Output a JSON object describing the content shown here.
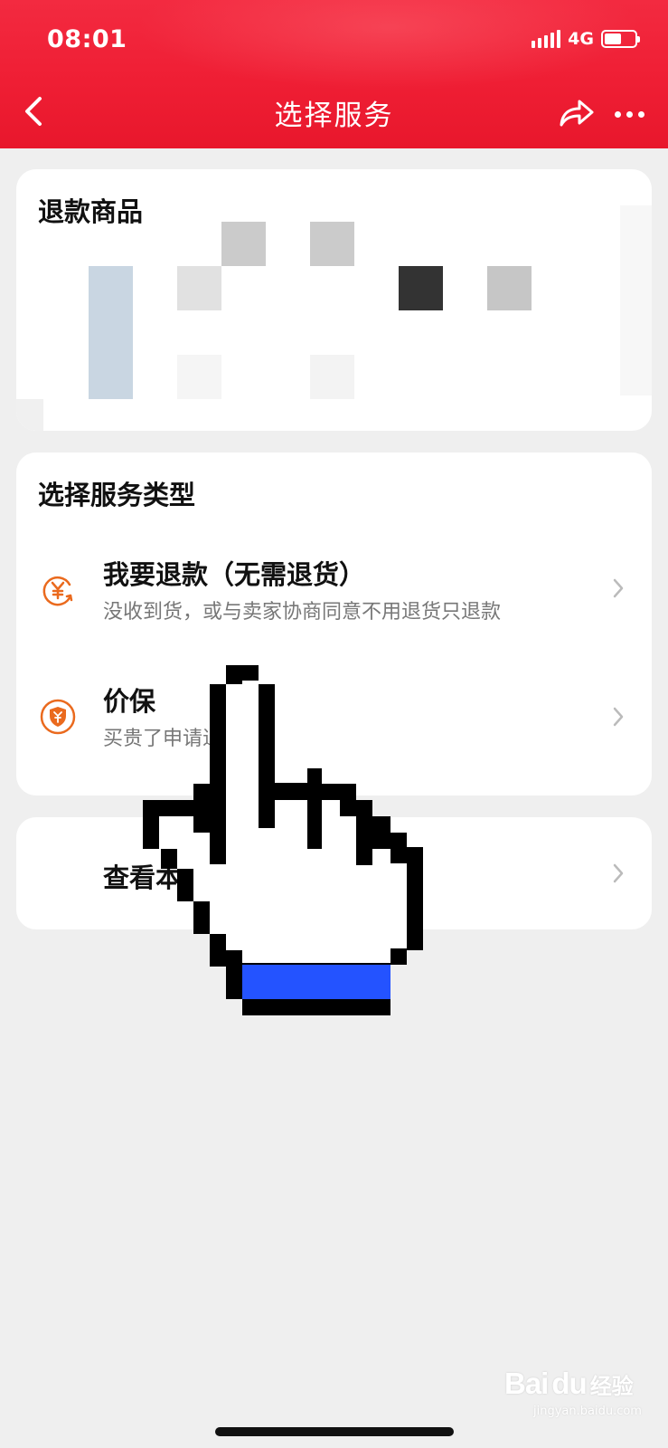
{
  "status_bar": {
    "time": "08:01",
    "network": "4G",
    "icons": [
      "signal-icon",
      "battery-icon"
    ]
  },
  "nav": {
    "title": "选择服务",
    "back_icon": "chevron-left-icon",
    "share_icon": "share-icon",
    "more_icon": "more-icon"
  },
  "refund_goods": {
    "title": "退款商品",
    "image_note": "pixelated product thumbnail"
  },
  "service_types": {
    "title": "选择服务类型",
    "options": [
      {
        "title": "我要退款（无需退货）",
        "subtitle": "没收到货，或与卖家协商同意不用退货只退款",
        "icon": "yen-refund-icon"
      },
      {
        "title": "价保",
        "subtitle": "买贵了申请退差额",
        "icon": "price-protect-icon"
      }
    ]
  },
  "view_more": {
    "label": "查看本"
  },
  "watermark": {
    "brand": "Bai",
    "brand2": "du",
    "text": "经验",
    "sub": "jingyan.baidu.com"
  },
  "colors": {
    "header": "#ef1e34",
    "accent_orange": "#ea6a1e",
    "cursor_blue": "#2453ff",
    "background": "#efefef"
  }
}
